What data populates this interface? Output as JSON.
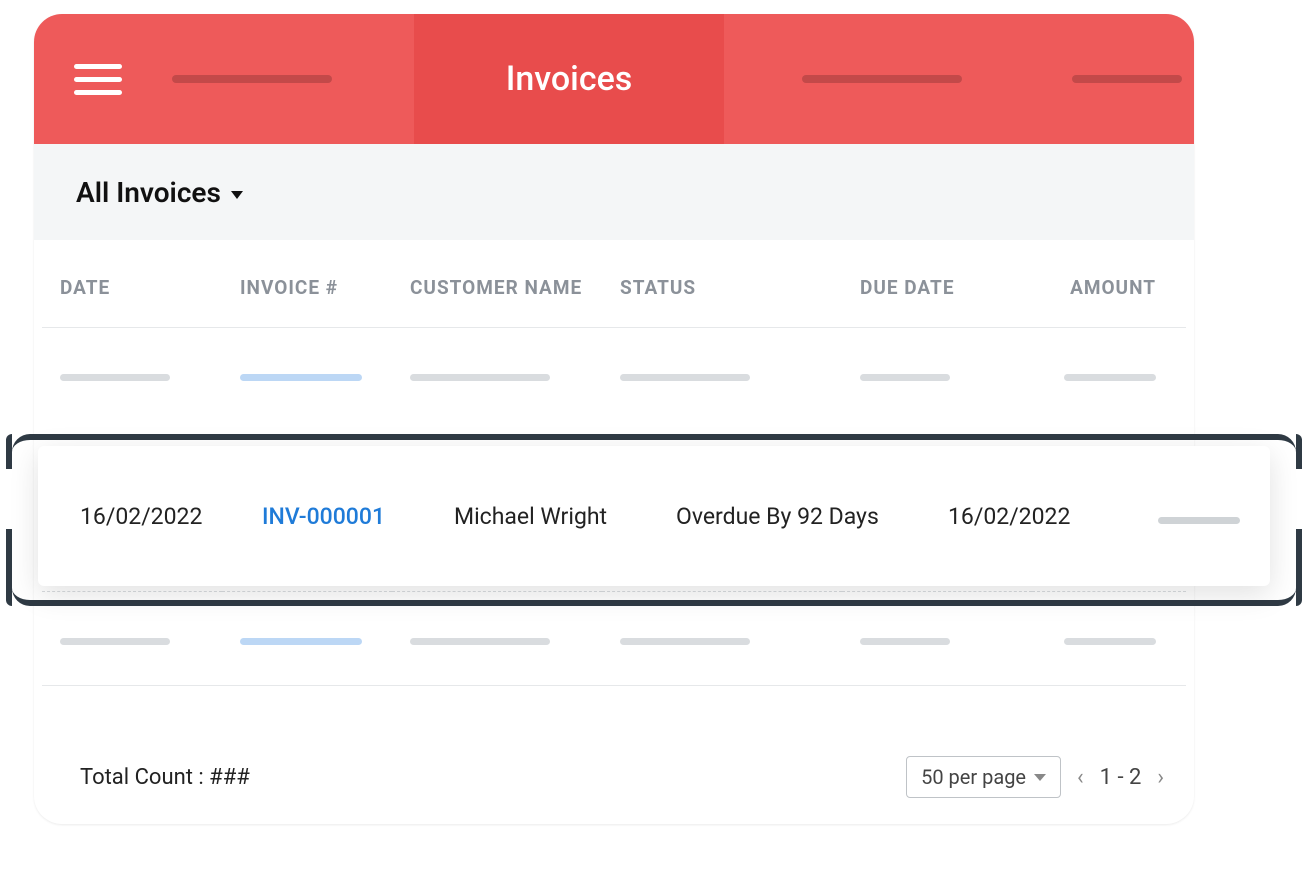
{
  "header": {
    "active_tab_label": "Invoices"
  },
  "subheader": {
    "filter_label": "All Invoices"
  },
  "table": {
    "columns": {
      "date": "DATE",
      "invoice": "INVOICE #",
      "customer": "CUSTOMER NAME",
      "status": "STATUS",
      "due_date": "DUE DATE",
      "amount": "AMOUNT"
    },
    "highlighted_row": {
      "date": "16/02/2022",
      "invoice": "INV-000001",
      "customer": "Michael Wright",
      "status": "Overdue By 92 Days",
      "due_date": "16/02/2022"
    }
  },
  "footer": {
    "total_count_label": "Total Count : ###",
    "per_page_label": "50 per page",
    "page_range": "1 - 2"
  }
}
